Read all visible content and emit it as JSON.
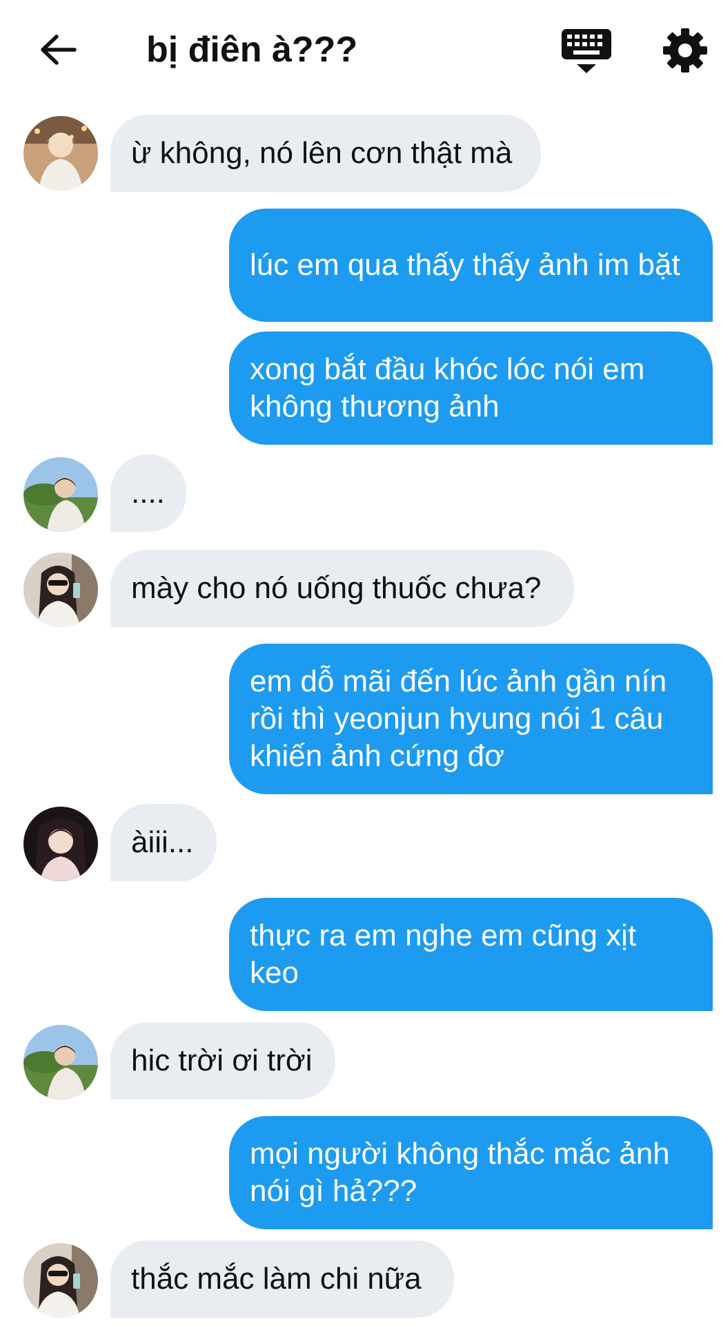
{
  "header": {
    "title": "bị điên à???",
    "back_icon": "arrow-left-icon",
    "keyboard_icon": "keyboard-icon",
    "settings_icon": "gear-icon"
  },
  "colors": {
    "outgoing_bubble": "#1d9bf0",
    "incoming_bubble": "#e9edf1",
    "text_dark": "#111111"
  },
  "messages": [
    {
      "side": "in",
      "avatar": "avatar-1",
      "text": "ừ không, nó lên cơn thật mà"
    },
    {
      "side": "out",
      "text": "lúc em qua thấy thấy ảnh im bặt"
    },
    {
      "side": "out",
      "text": "xong bắt đầu khóc lóc nói em không thương ảnh"
    },
    {
      "side": "in",
      "avatar": "avatar-2",
      "text": "...."
    },
    {
      "side": "in",
      "avatar": "avatar-3",
      "text": "mày cho nó uống thuốc chưa?"
    },
    {
      "side": "out",
      "text": "em dỗ mãi đến lúc ảnh gần nín rồi thì yeonjun hyung nói 1 câu khiến ảnh cứng đơ"
    },
    {
      "side": "in",
      "avatar": "avatar-4",
      "text": "àiii..."
    },
    {
      "side": "out",
      "text": "thực ra em nghe em cũng xịt keo"
    },
    {
      "side": "in",
      "avatar": "avatar-2",
      "text": "hic trời ơi trời"
    },
    {
      "side": "out",
      "text": "mọi người không thắc mắc ảnh nói gì hả???"
    },
    {
      "side": "in",
      "avatar": "avatar-3",
      "text": "thắc mắc làm chi nữa"
    }
  ]
}
